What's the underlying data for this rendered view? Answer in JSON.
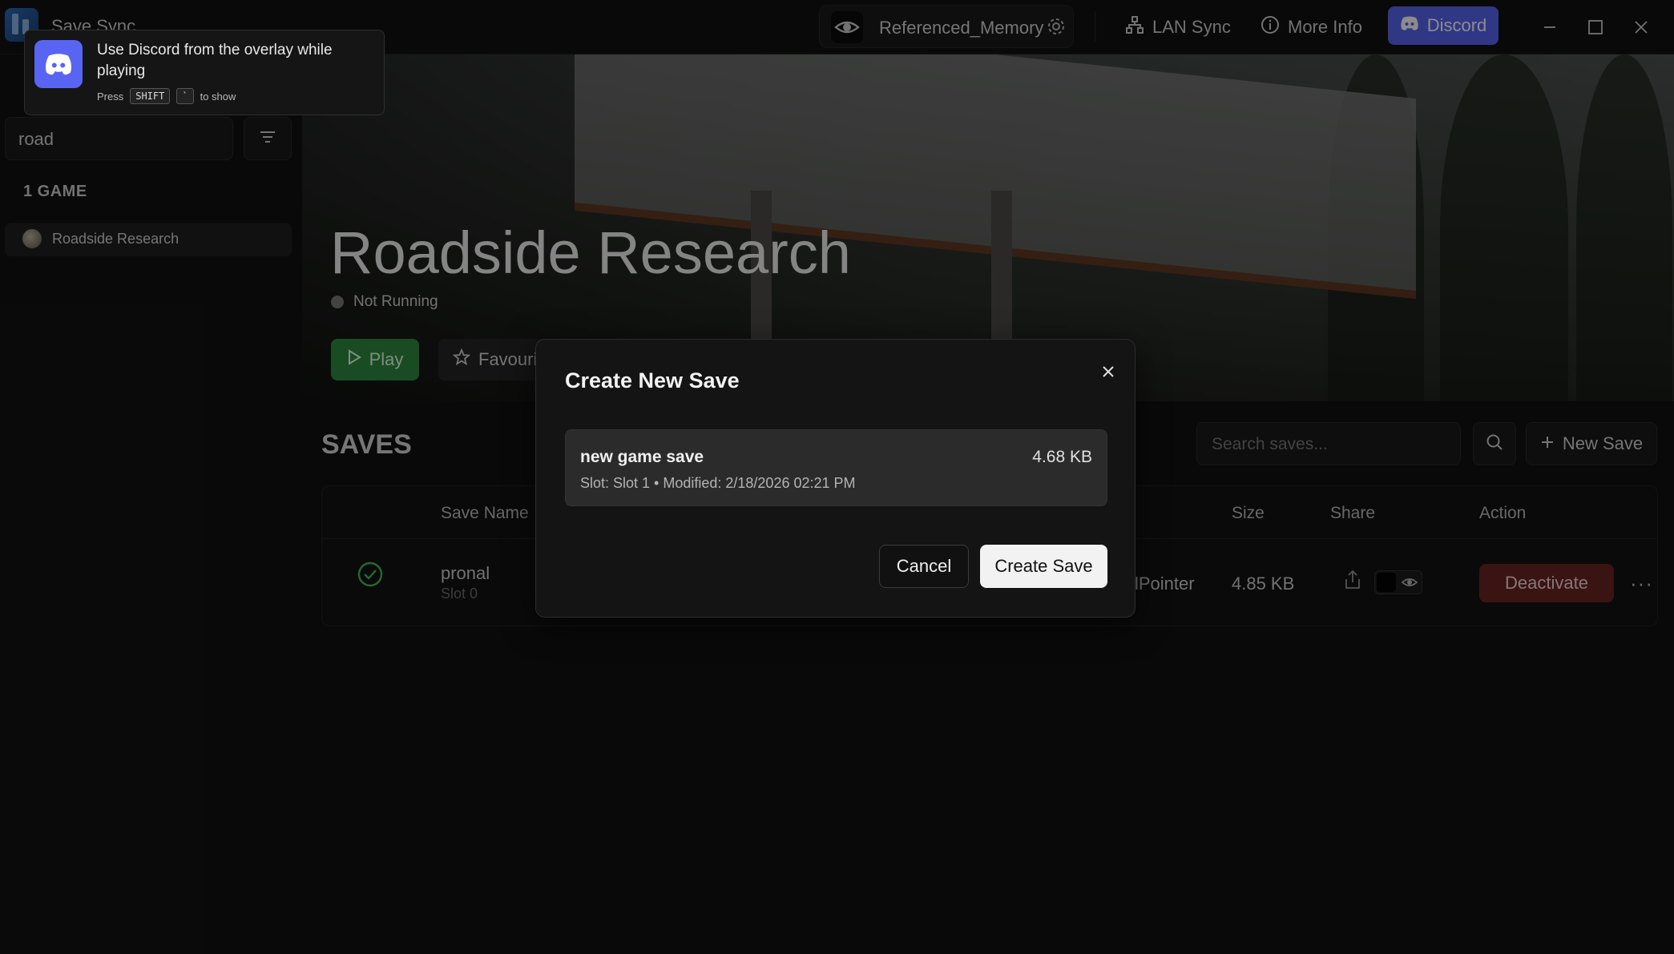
{
  "app": {
    "title": "Save Sync"
  },
  "titlebar": {
    "profile_name": "Referenced_Memory",
    "lan_sync_label": "LAN Sync",
    "more_info_label": "More Info",
    "discord_label": "Discord"
  },
  "sidebar": {
    "search_value": "road",
    "games_count_label": "1 GAME",
    "games": [
      {
        "label": "Roadside Research"
      }
    ]
  },
  "hero": {
    "game_title": "Roadside Research",
    "status_text": "Not Running",
    "play_label": "Play",
    "favourite_label": "Favourite"
  },
  "saves": {
    "section_title": "SAVES",
    "search_placeholder": "Search saves...",
    "new_save_label": "New Save",
    "columns": {
      "save_name": "Save Name",
      "size": "Size",
      "share": "Share",
      "action": "Action"
    },
    "rows": [
      {
        "name": "pronal",
        "slot": "Slot 0",
        "author": "lPointer",
        "size": "4.85 KB",
        "action_label": "Deactivate"
      }
    ]
  },
  "modal": {
    "title": "Create New Save",
    "save_name": "new game save",
    "save_size": "4.68 KB",
    "save_meta": "Slot: Slot 1 • Modified: 2/18/2026 02:21 PM",
    "cancel_label": "Cancel",
    "create_label": "Create Save"
  },
  "toast": {
    "message": "Use Discord from the overlay while playing",
    "hint_prefix": "Press",
    "key1": "SHIFT",
    "key2": "`",
    "hint_suffix": "to show"
  },
  "colors": {
    "accent_discord": "#5865f2",
    "play_green": "#2e8a3e",
    "deactivate_red": "#6a2424",
    "active_check": "#3fbf5a"
  },
  "icons": [
    "app-logo",
    "eye-icon",
    "gear-icon",
    "network-icon",
    "info-icon",
    "discord-icon",
    "minimize-icon",
    "maximize-icon",
    "close-icon",
    "filter-icon",
    "play-icon",
    "star-icon",
    "search-icon",
    "plus-icon",
    "check-circle-icon",
    "share-icon",
    "more-icon"
  ]
}
